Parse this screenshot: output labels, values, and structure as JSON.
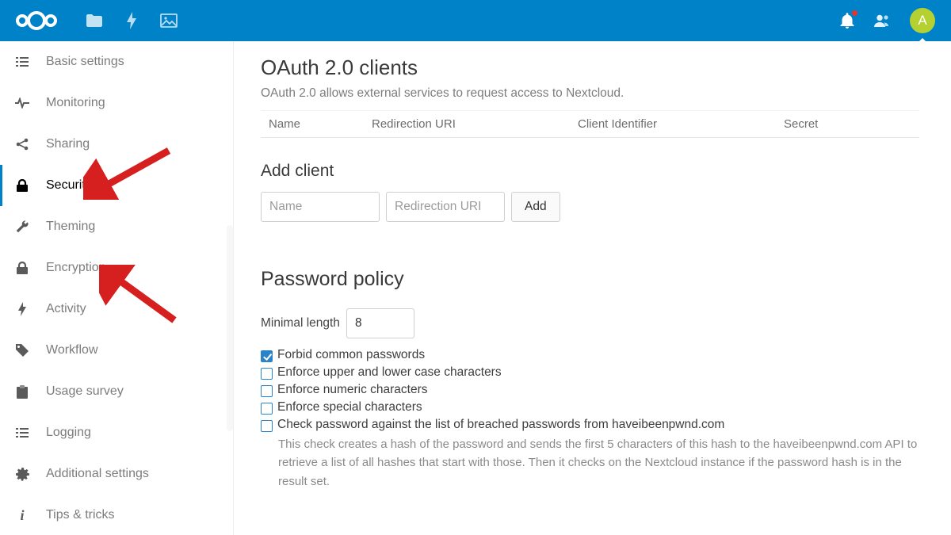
{
  "header": {
    "avatar_letter": "A"
  },
  "sidebar": {
    "items": [
      {
        "label": "Basic settings",
        "icon": "list"
      },
      {
        "label": "Monitoring",
        "icon": "pulse"
      },
      {
        "label": "Sharing",
        "icon": "share"
      },
      {
        "label": "Security",
        "icon": "lock",
        "active": true
      },
      {
        "label": "Theming",
        "icon": "wrench"
      },
      {
        "label": "Encryption",
        "icon": "lock"
      },
      {
        "label": "Activity",
        "icon": "bolt"
      },
      {
        "label": "Workflow",
        "icon": "tag"
      },
      {
        "label": "Usage survey",
        "icon": "clipboard"
      },
      {
        "label": "Logging",
        "icon": "list2"
      },
      {
        "label": "Additional settings",
        "icon": "gear"
      },
      {
        "label": "Tips & tricks",
        "icon": "info"
      }
    ]
  },
  "oauth": {
    "title": "OAuth 2.0 clients",
    "subtitle": "OAuth 2.0 allows external services to request access to Nextcloud.",
    "columns": {
      "name": "Name",
      "redirect": "Redirection URI",
      "client_id": "Client Identifier",
      "secret": "Secret"
    },
    "add_title": "Add client",
    "add_name_placeholder": "Name",
    "add_uri_placeholder": "Redirection URI",
    "add_button": "Add"
  },
  "password_policy": {
    "title": "Password policy",
    "min_label": "Minimal length",
    "min_value": "8",
    "checks": {
      "forbid_common": "Forbid common passwords",
      "enforce_case": "Enforce upper and lower case characters",
      "enforce_numeric": "Enforce numeric characters",
      "enforce_special": "Enforce special characters",
      "check_breached": "Check password against the list of breached passwords from haveibeenpwnd.com"
    },
    "breach_hint": "This check creates a hash of the password and sends the first 5 characters of this hash to the haveibeenpwnd.com API to retrieve a list of all hashes that start with those. Then it checks on the Nextcloud instance if the password hash is in the result set."
  }
}
